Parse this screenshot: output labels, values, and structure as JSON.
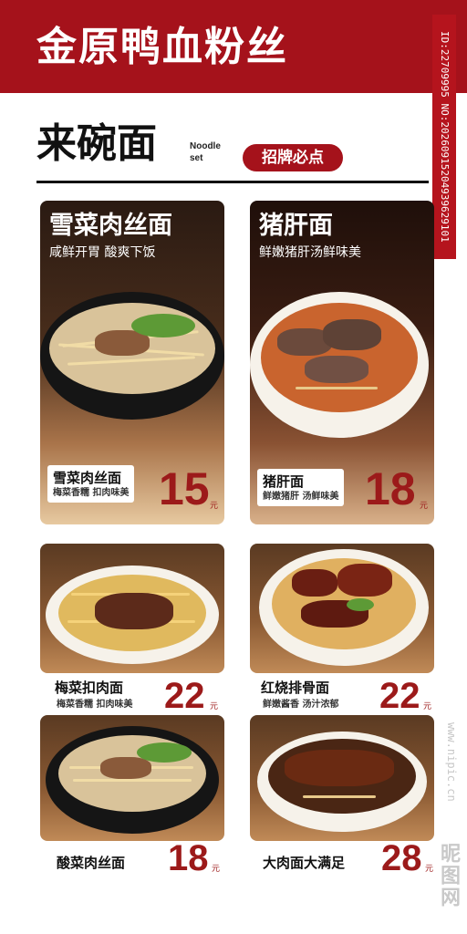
{
  "header": {
    "title": "金原鸭血粉丝"
  },
  "side_code": "ID:22709995 NO:20260915204939629101",
  "section": {
    "title": "来碗面",
    "subtitle": "Noodle\nset",
    "badge": "招牌必点"
  },
  "featured": [
    {
      "name": "雪菜肉丝面",
      "desc": "咸鲜开胃 酸爽下饭",
      "label_name": "雪菜肉丝面",
      "label_desc": "梅菜香糯 扣肉味美",
      "price": "15",
      "unit": "元"
    },
    {
      "name": "猪肝面",
      "desc": "鲜嫩猪肝汤鲜味美",
      "label_name": "猪肝面",
      "label_desc": "鲜嫩猪肝 汤鲜味美",
      "price": "18",
      "unit": "元"
    }
  ],
  "items": [
    {
      "name": "梅菜扣肉面",
      "desc": "梅菜香糯 扣肉味美",
      "price": "22",
      "unit": "元"
    },
    {
      "name": "红烧排骨面",
      "desc": "鲜嫩酱香 汤汁浓郁",
      "price": "22",
      "unit": "元"
    },
    {
      "name": "酸菜肉丝面",
      "desc": "",
      "price": "18",
      "unit": "元"
    },
    {
      "name": "大肉面大满足",
      "desc": "",
      "price": "28",
      "unit": "元"
    }
  ],
  "watermark": "www.nipic.cn",
  "logo": "昵图网",
  "colors": {
    "brand_red": "#a5121b",
    "price_red": "#9c1a1a"
  }
}
